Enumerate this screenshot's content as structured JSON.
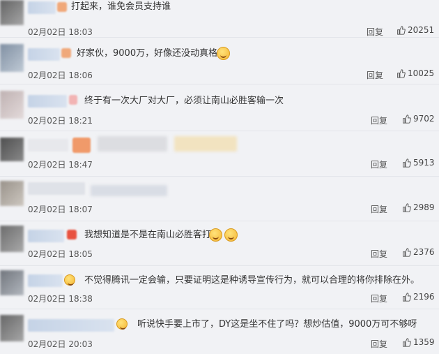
{
  "comments": [
    {
      "text": "打起来，谁免会员支持谁",
      "time": "02月02日 18:03",
      "reply": "回复",
      "likes": "20251"
    },
    {
      "text": "好家伙，9000万，好像还没动真格的",
      "time": "02月02日 18:06",
      "reply": "回复",
      "likes": "10025"
    },
    {
      "text": "终于有一次大厂对大厂，必须让南山必胜客输一次",
      "time": "02月02日 18:21",
      "reply": "回复",
      "likes": "9702"
    },
    {
      "text": "",
      "time": "02月02日 18:47",
      "reply": "回复",
      "likes": "5913"
    },
    {
      "text": "",
      "time": "02月02日 18:07",
      "reply": "回复",
      "likes": "2989"
    },
    {
      "text": "我想知道是不是在南山必胜客打",
      "time": "02月02日 18:05",
      "reply": "回复",
      "likes": "2376"
    },
    {
      "text": "不觉得腾讯一定会输，只要证明这是种诱导宣传行为，就可以合理的将你排除在外。",
      "time": "02月02日 18:38",
      "reply": "回复",
      "likes": "2196"
    },
    {
      "text": "听说快手要上市了，DY这是坐不住了吗？想炒估值，9000万可不够呀",
      "time": "02月02日 20:03",
      "reply": "回复",
      "likes": "1359"
    }
  ]
}
